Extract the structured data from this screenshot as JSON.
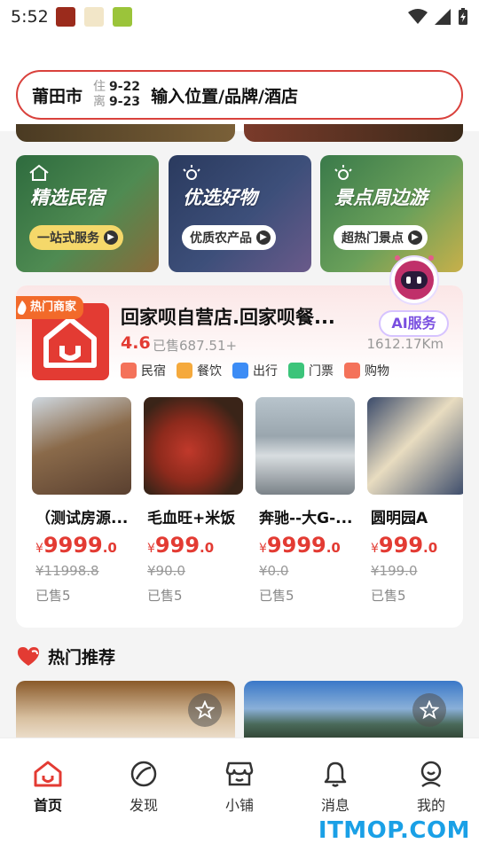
{
  "status_bar": {
    "time": "5:52"
  },
  "search": {
    "city": "莆田市",
    "checkin_label": "住",
    "checkin_date": "9-22",
    "checkout_label": "离",
    "checkout_date": "9-23",
    "placeholder": "输入位置/品牌/酒店"
  },
  "banners": [
    {
      "title": "精选民宿",
      "pill": "一站式服务",
      "pill_color": "#f5d86a"
    },
    {
      "title": "优选好物",
      "pill": "优质农产品",
      "pill_color": "#ffffff"
    },
    {
      "title": "景点周边游",
      "pill": "超热门景点",
      "pill_color": "#ffffff"
    }
  ],
  "ai_button": {
    "label": "AI服务"
  },
  "shop": {
    "tag": "热门商家",
    "name": "回家呗自营店.回家呗餐...",
    "rating": "4.6",
    "sold": "已售687.51+",
    "distance": "1612.17Km",
    "categories": [
      {
        "label": "民宿",
        "icon": "homestay-icon",
        "color": "#f4725a"
      },
      {
        "label": "餐饮",
        "icon": "dining-icon",
        "color": "#f5a93c"
      },
      {
        "label": "出行",
        "icon": "bus-icon",
        "color": "#3c8cf5"
      },
      {
        "label": "门票",
        "icon": "ticket-icon",
        "color": "#3cc47a"
      },
      {
        "label": "购物",
        "icon": "shopping-icon",
        "color": "#f4725a"
      }
    ],
    "products": [
      {
        "name": "（测试房源...",
        "currency": "¥",
        "price_int": "9999",
        "price_dec": ".0",
        "original": "¥11998.8",
        "sold": "已售5"
      },
      {
        "name": "毛血旺+米饭",
        "currency": "¥",
        "price_int": "999",
        "price_dec": ".0",
        "original": "¥90.0",
        "sold": "已售5"
      },
      {
        "name": "奔驰--大G-...",
        "currency": "¥",
        "price_int": "9999",
        "price_dec": ".0",
        "original": "¥0.0",
        "sold": "已售5"
      },
      {
        "name": "圆明园A",
        "currency": "¥",
        "price_int": "999",
        "price_dec": ".0",
        "original": "¥199.0",
        "sold": "已售5"
      }
    ]
  },
  "recommend": {
    "title": "热门推荐"
  },
  "tabs": [
    {
      "label": "首页",
      "icon": "home-icon"
    },
    {
      "label": "发现",
      "icon": "compass-icon"
    },
    {
      "label": "小铺",
      "icon": "store-icon"
    },
    {
      "label": "消息",
      "icon": "bell-icon"
    },
    {
      "label": "我的",
      "icon": "profile-icon"
    }
  ],
  "watermark": "ITMOP.COM",
  "colors": {
    "accent": "#e33b33",
    "ai_purple": "#7a4fe0",
    "hot_tag": "#f26a2a"
  }
}
